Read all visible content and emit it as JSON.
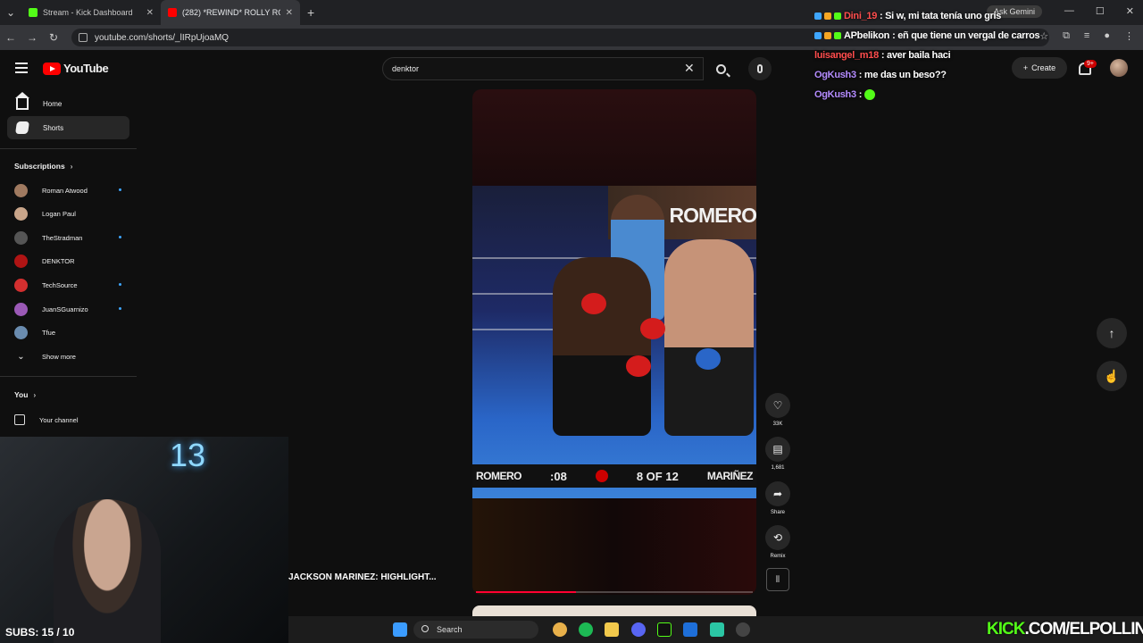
{
  "browser": {
    "tabs": [
      {
        "title": "Stream - Kick Dashboard",
        "active": false,
        "favicon_color": "#53fc18"
      },
      {
        "title": "(282) *REWIND* ROLLY RO",
        "active": true,
        "favicon_color": "#ff0000"
      }
    ],
    "new_tab": "+",
    "url": "youtube.com/shorts/_lIRpUjoaMQ",
    "gemini_label": "Ask Gemini"
  },
  "youtube": {
    "logo_text": "YouTube",
    "search_value": "denktor",
    "create_label": "Create",
    "notif_count": "9+"
  },
  "sidebar": {
    "home": "Home",
    "shorts": "Shorts",
    "subscriptions_label": "Subscriptions",
    "subscriptions": [
      {
        "name": "Roman Atwood",
        "dot": true,
        "color": "#a07a60"
      },
      {
        "name": "Logan Paul",
        "dot": false,
        "color": "#c9a58a"
      },
      {
        "name": "TheStradman",
        "dot": true,
        "color": "#555"
      },
      {
        "name": "DENKTOR",
        "dot": false,
        "color": "#b01414"
      },
      {
        "name": "TechSource",
        "dot": true,
        "color": "#d32f2f"
      },
      {
        "name": "JuanSGuarnizo",
        "dot": true,
        "color": "#9b59b6"
      },
      {
        "name": "Tfue",
        "dot": false,
        "color": "#6a8caf"
      }
    ],
    "show_more": "Show more",
    "you_label": "You",
    "your_channel": "Your channel"
  },
  "short": {
    "banner_name": "ROMERO",
    "score_left": "ROMERO",
    "score_time": ":08",
    "score_round": "8 OF 12",
    "score_right": "MARIÑEZ",
    "progress": 0.36,
    "video_title": "JACKSON MARINEZ: HIGHLIGHT..."
  },
  "actions": {
    "likes": "33K",
    "comments": "1,681",
    "share": "Share",
    "remix": "Remix"
  },
  "chat": [
    {
      "user": "Dini_19",
      "user_color": "#ff4d4d",
      "msg": ": Si w, mi tata tenía uno gris"
    },
    {
      "user": "APbelikon",
      "user_color": "#ffffff",
      "msg": ": eñ que tiene un vergal de carros"
    },
    {
      "user": "luisangel_m18",
      "user_color": "#ff4d4d",
      "msg": ": aver baila haci"
    },
    {
      "user": "OgKush3",
      "user_color": "#b48cff",
      "msg": ": me das un beso??"
    },
    {
      "user": "OgKush3",
      "user_color": "#b48cff",
      "msg": ":"
    }
  ],
  "webcam": {
    "number": "13",
    "subs": "SUBS: 15 / 10"
  },
  "taskbar": {
    "search_label": "Search"
  },
  "watermark": {
    "brand": "KICK",
    "rest": ".COM/ELPOLLIN"
  }
}
